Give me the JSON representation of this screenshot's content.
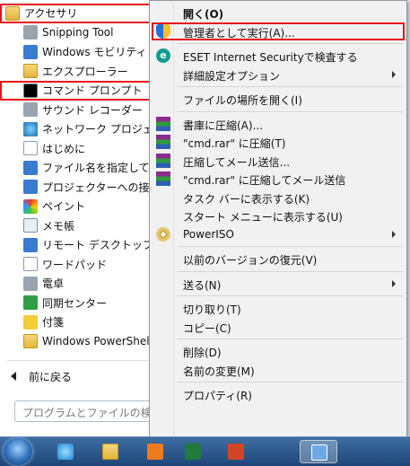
{
  "programs": [
    {
      "label": "アクセサリ",
      "icon": "folder-icon",
      "level": 0,
      "highlighted": true
    },
    {
      "label": "Snipping Tool",
      "icon": "snipping-tool-icon",
      "level": 1
    },
    {
      "label": "Windows モビリティ",
      "icon": "mobility-center-icon",
      "level": 1
    },
    {
      "label": "エクスプローラー",
      "icon": "explorer-folder-icon",
      "level": 1
    },
    {
      "label": "コマンド プロンプト",
      "icon": "command-prompt-icon",
      "level": 1,
      "highlighted": true
    },
    {
      "label": "サウンド レコーダー",
      "icon": "microphone-icon",
      "level": 1
    },
    {
      "label": "ネットワーク プロジェ",
      "icon": "network-projector-icon",
      "level": 1
    },
    {
      "label": "はじめに",
      "icon": "getting-started-icon",
      "level": 1
    },
    {
      "label": "ファイル名を指定して",
      "icon": "run-icon",
      "level": 1
    },
    {
      "label": "プロジェクターへの接",
      "icon": "projector-icon",
      "level": 1
    },
    {
      "label": "ペイント",
      "icon": "paint-icon",
      "level": 1
    },
    {
      "label": "メモ帳",
      "icon": "notepad-icon",
      "level": 1
    },
    {
      "label": "リモート デスクトップ",
      "icon": "remote-desktop-icon",
      "level": 1
    },
    {
      "label": "ワードパッド",
      "icon": "wordpad-icon",
      "level": 1
    },
    {
      "label": "電卓",
      "icon": "calculator-icon",
      "level": 1
    },
    {
      "label": "同期センター",
      "icon": "sync-center-icon",
      "level": 1
    },
    {
      "label": "付箋",
      "icon": "sticky-notes-icon",
      "level": 1
    },
    {
      "label": "Windows PowerShell",
      "icon": "powershell-folder-icon",
      "level": 1
    }
  ],
  "back_label": "前に戻る",
  "search_placeholder": "プログラムとファイルの検",
  "context_menu": [
    {
      "label": "開く(O)",
      "icon": "",
      "bold": true
    },
    {
      "label": "管理者として実行(A)...",
      "icon": "uac-shield-icon",
      "highlighted": true
    },
    {
      "sep": true
    },
    {
      "label": "ESET Internet Securityで検査する",
      "icon": "eset-icon"
    },
    {
      "label": "詳細設定オプション",
      "icon": "",
      "submenu": true
    },
    {
      "sep": true
    },
    {
      "label": "ファイルの場所を開く(I)",
      "icon": ""
    },
    {
      "sep": true
    },
    {
      "label": "書庫に圧縮(A)...",
      "icon": "winrar-icon"
    },
    {
      "label": "\"cmd.rar\" に圧縮(T)",
      "icon": "winrar-icon"
    },
    {
      "label": "圧縮してメール送信...",
      "icon": "winrar-icon"
    },
    {
      "label": "\"cmd.rar\" に圧縮してメール送信",
      "icon": "winrar-icon"
    },
    {
      "label": "タスク バーに表示する(K)",
      "icon": ""
    },
    {
      "label": "スタート メニューに表示する(U)",
      "icon": ""
    },
    {
      "label": "PowerISO",
      "icon": "poweriso-icon",
      "submenu": true
    },
    {
      "sep": true
    },
    {
      "label": "以前のバージョンの復元(V)",
      "icon": ""
    },
    {
      "sep": true
    },
    {
      "label": "送る(N)",
      "icon": "",
      "submenu": true
    },
    {
      "sep": true
    },
    {
      "label": "切り取り(T)",
      "icon": ""
    },
    {
      "label": "コピー(C)",
      "icon": ""
    },
    {
      "sep": true
    },
    {
      "label": "削除(D)",
      "icon": ""
    },
    {
      "label": "名前の変更(M)",
      "icon": ""
    },
    {
      "sep": true
    },
    {
      "label": "プロパティ(R)",
      "icon": ""
    }
  ],
  "taskbar": [
    {
      "icon": "internet-explorer-icon"
    },
    {
      "icon": "file-explorer-icon"
    },
    {
      "icon": "media-player-icon"
    },
    {
      "icon": "excel-icon"
    },
    {
      "icon": "powerpoint-icon"
    },
    {
      "icon": "remote-desktop-taskbar-icon",
      "active": true
    }
  ],
  "highlight_color": "#e8141b"
}
